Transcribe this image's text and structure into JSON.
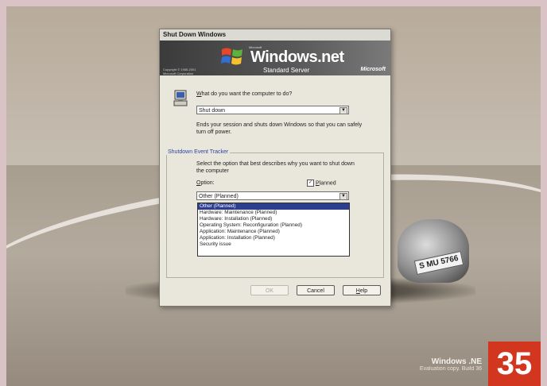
{
  "page": {
    "number": "35"
  },
  "desktop": {
    "plate_text": "S MU 5766",
    "watermark_title": "Windows .NE",
    "watermark_sub": "Evaluation copy. Build 36"
  },
  "dialog": {
    "title": "Shut Down Windows",
    "banner": {
      "ms_small": "Microsoft",
      "product": "Windows.net",
      "edition": "Standard Server",
      "copyright_line1": "Copyright © 1985-2001",
      "copyright_line2": "Microsoft Corporation",
      "logo": "Microsoft"
    },
    "question_underline": "W",
    "question_rest": "hat do you want the computer to do?",
    "action_value": "Shut down",
    "action_description": "Ends your session and shuts down Windows so that you can safely turn off power.",
    "tracker_label": "Shutdown Event Tracker",
    "tracker_description": "Select the option that best describes why you want to shut down the computer",
    "option_underline": "O",
    "option_rest": "ption:",
    "planned_checked": "✓",
    "planned_underline": "P",
    "planned_rest": "lanned",
    "option_value": "Other (Planned)",
    "reasons": [
      "Other (Planned)",
      "Hardware: Maintenance (Planned)",
      "Hardware: Installation (Planned)",
      "Operating System: Reconfiguration (Planned)",
      "Application: Maintenance (Planned)",
      "Application: Installation (Planned)",
      "Security issue"
    ],
    "buttons": {
      "ok": "OK",
      "cancel": "Cancel",
      "help_underline": "H",
      "help_rest": "elp"
    }
  },
  "colors": {
    "selection": "#2d3f8c",
    "page_badge": "#d3361f",
    "group_label": "#2c46a4"
  }
}
